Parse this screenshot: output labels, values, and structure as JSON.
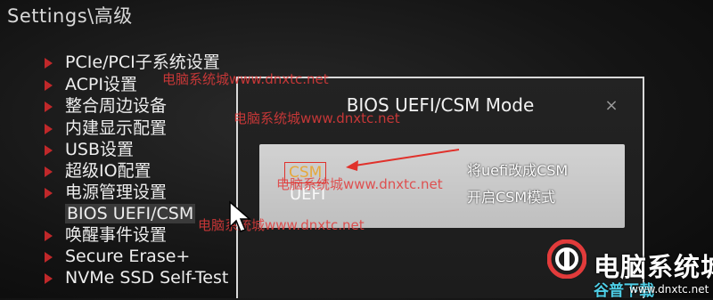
{
  "breadcrumb": "Settings\\高级",
  "menu": {
    "items": [
      {
        "label": "PCIe/PCI子系统设置"
      },
      {
        "label": "ACPI设置"
      },
      {
        "label": "整合周边设备"
      },
      {
        "label": "内建显示配置"
      },
      {
        "label": "USB设置"
      },
      {
        "label": "超级IO配置"
      },
      {
        "label": "电源管理设置"
      },
      {
        "label": "BIOS UEFI/CSM"
      },
      {
        "label": "唤醒事件设置"
      },
      {
        "label": "Secure Erase+"
      },
      {
        "label": "NVMe SSD Self-Test"
      }
    ]
  },
  "dialog": {
    "title": "BIOS UEFI/CSM Mode",
    "close": "×",
    "options": [
      "CSM",
      "UEFI"
    ],
    "selected": "CSM"
  },
  "annotations": {
    "line1": "将uefi改成CSM",
    "line2": "开启CSM模式"
  },
  "watermarks": {
    "w1": "电脑系统城www.dnxtc.net",
    "w2": "电脑系统城www.dnxtc.net",
    "w3": "电脑系统城www.dnxtc.net",
    "w4": "电脑系统城www.dnxtc.net"
  },
  "brand": {
    "name": "电脑系统城",
    "tagline": "谷普下载",
    "url": "www.dnxtc.net"
  },
  "colors": {
    "arrow_red": "#c0282a",
    "highlight_box": "#e0312b",
    "csm_text": "#e6a83c",
    "watermark": "#e23b3b"
  }
}
